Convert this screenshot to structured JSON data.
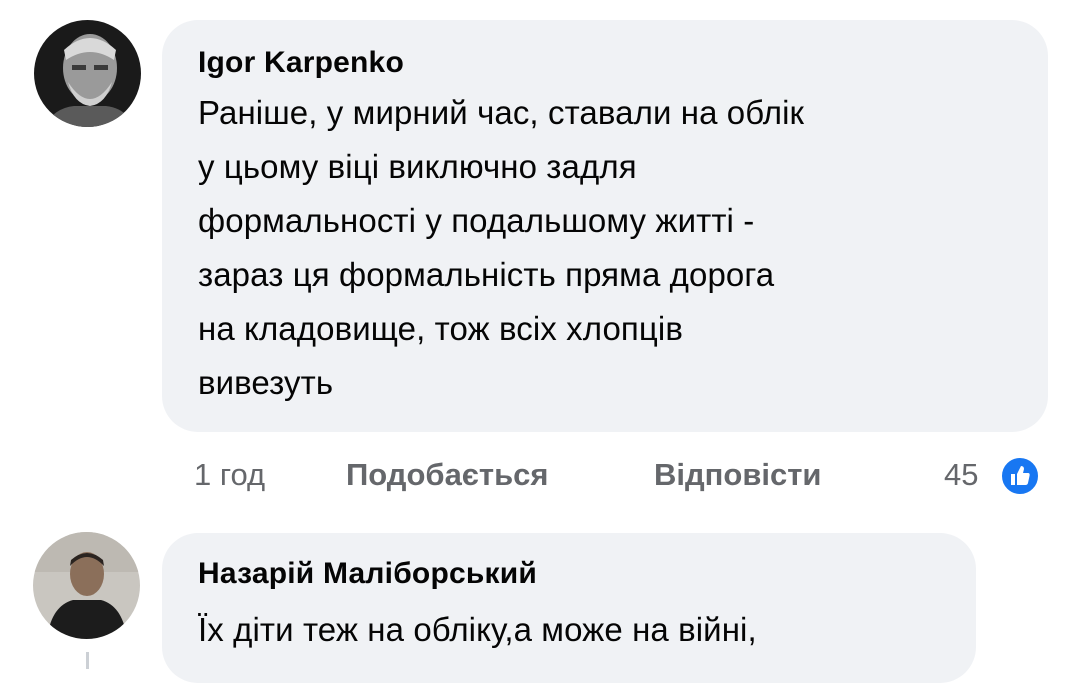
{
  "comments": [
    {
      "author": "Igor  Karpenko",
      "lines": [
        "Раніше, у мирний час, ставали на облік",
        "у цьому віці виключно задля",
        "формальності у подальшому житті -",
        "зараз ця формальність пряма дорога",
        "на кладовище, тож всіх хлопців",
        "вивезуть"
      ],
      "time": "1 год",
      "like_label": "Подобається",
      "reply_label": "Відповісти",
      "reaction_count": "45",
      "reaction_icon": "thumbs-up-icon"
    },
    {
      "author": "Назарій Маліборський",
      "lines": [
        "Їх діти теж на обліку,а може на війні,"
      ]
    }
  ],
  "colors": {
    "bubble_bg": "#f0f2f5",
    "meta_text": "#65676b",
    "like_blue": "#1877f2"
  }
}
